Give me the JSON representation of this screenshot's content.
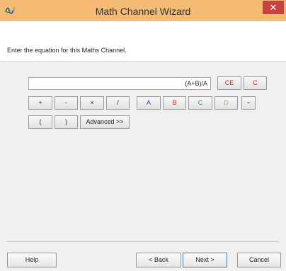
{
  "window": {
    "title": "Math Channel Wizard",
    "close_glyph": "✕"
  },
  "instruction": "Enter the equation for this Maths Channel.",
  "equation": {
    "value": "(A+B)/A"
  },
  "buttons": {
    "ce": "CE",
    "c": "C",
    "plus": "+",
    "minus": "-",
    "multiply": "×",
    "divide": "/",
    "a": "A",
    "b": "B",
    "ch_c": "C",
    "d": "D",
    "dropdown_glyph": "⌄",
    "open_paren": "(",
    "close_paren": ")",
    "advanced": "Advanced >>"
  },
  "footer": {
    "help": "Help",
    "back": "< Back",
    "next": "Next >",
    "cancel": "Cancel"
  },
  "colors": {
    "titlebar": "#f5ba74",
    "close": "#c94141",
    "ch_a": "#1f3fd0",
    "ch_b": "#d01f1f",
    "ch_c": "#2c9a2c",
    "ch_d": "#d8a020",
    "clear_red": "#d01f1f"
  },
  "icons": {
    "app": "pico-wave-icon",
    "close": "close-icon",
    "dropdown": "chevron-down-icon"
  }
}
